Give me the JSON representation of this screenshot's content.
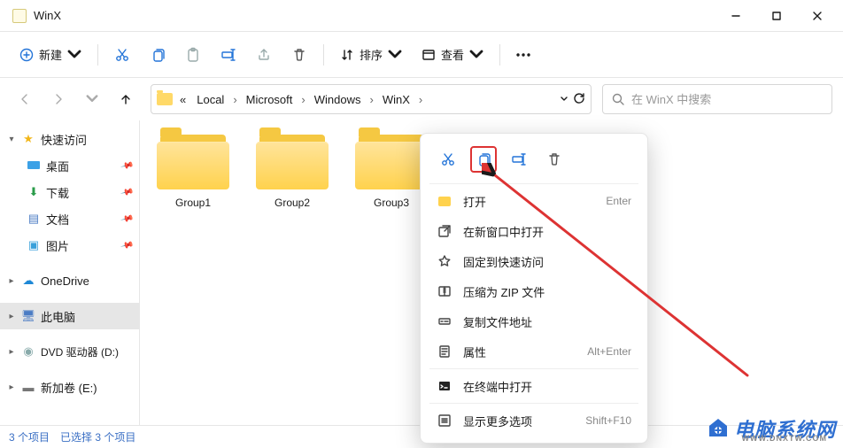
{
  "window": {
    "title": "WinX"
  },
  "toolbar": {
    "new_label": "新建",
    "sort_label": "排序",
    "view_label": "查看"
  },
  "breadcrumb": {
    "prefix": "«",
    "items": [
      "Local",
      "Microsoft",
      "Windows",
      "WinX"
    ]
  },
  "search": {
    "placeholder": "在 WinX 中搜索"
  },
  "sidebar": {
    "quick_access": "快速访问",
    "desktop": "桌面",
    "downloads": "下载",
    "documents": "文档",
    "pictures": "图片",
    "onedrive": "OneDrive",
    "this_pc": "此电脑",
    "dvd": "DVD 驱动器 (D:)",
    "volume": "新加卷 (E:)"
  },
  "folders": [
    {
      "name": "Group1"
    },
    {
      "name": "Group2"
    },
    {
      "name": "Group3"
    }
  ],
  "context": {
    "open": "打开",
    "open_sc": "Enter",
    "open_new": "在新窗口中打开",
    "pin_qa": "固定到快速访问",
    "zip": "压缩为 ZIP 文件",
    "copy_path": "复制文件地址",
    "properties": "属性",
    "properties_sc": "Alt+Enter",
    "terminal": "在终端中打开",
    "more": "显示更多选项",
    "more_sc": "Shift+F10"
  },
  "status": {
    "count": "3 个项目",
    "selected": "已选择 3 个项目"
  },
  "watermark": {
    "cn": "电脑系统网",
    "en": "WWW.DNXTW.COM"
  }
}
